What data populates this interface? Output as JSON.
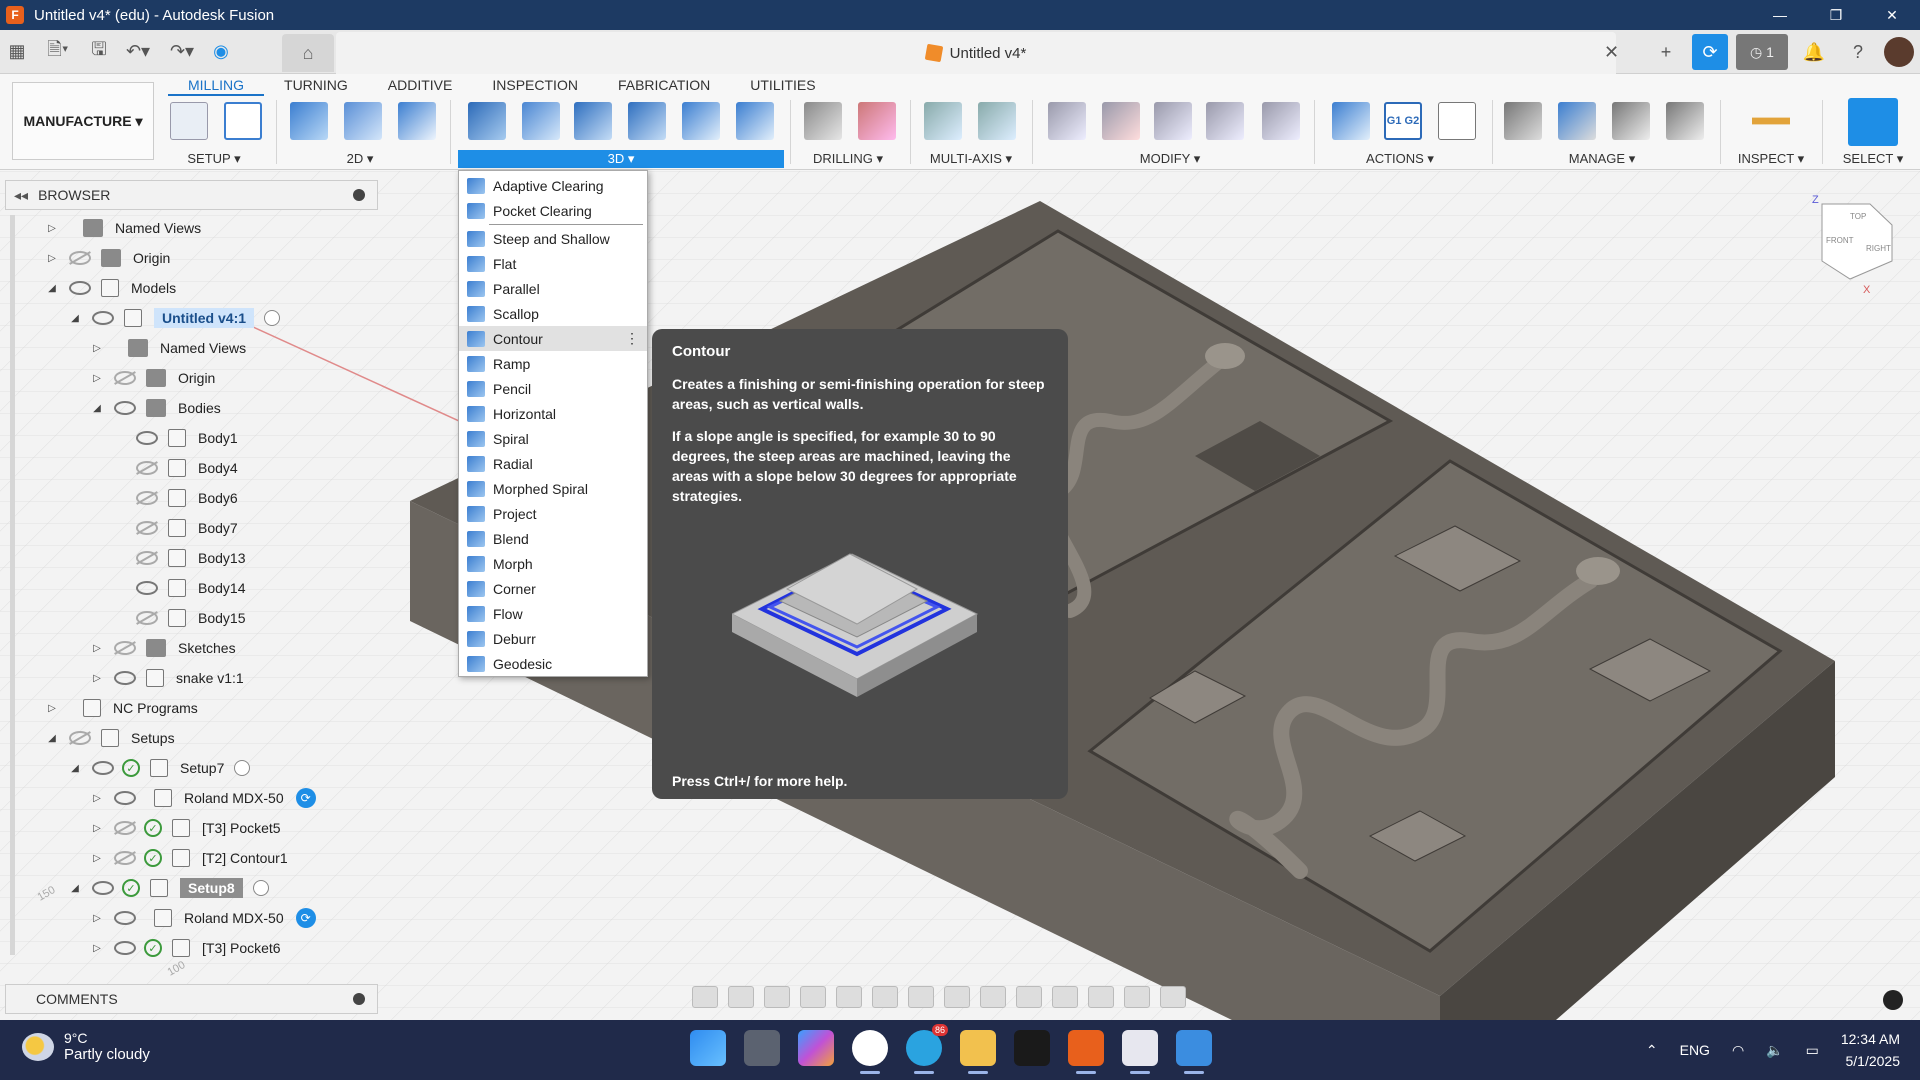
{
  "window": {
    "title": "Untitled v4* (edu) - Autodesk Fusion",
    "controls": [
      "—",
      "❐",
      "✕"
    ]
  },
  "document": {
    "tab_title": "Untitled v4*",
    "jobs_count": "1"
  },
  "ribbon": {
    "workspace": "MANUFACTURE ▾",
    "tabs": [
      "MILLING",
      "TURNING",
      "ADDITIVE",
      "INSPECTION",
      "FABRICATION",
      "UTILITIES"
    ],
    "groups": {
      "setup": "SETUP ▾",
      "two_d": "2D ▾",
      "three_d": "3D ▾",
      "drilling": "DRILLING ▾",
      "multi_axis": "MULTI-AXIS ▾",
      "modify": "MODIFY ▾",
      "actions": "ACTIONS ▾",
      "manage": "MANAGE ▾",
      "inspect": "INSPECT ▾",
      "select": "SELECT ▾"
    },
    "actions_g1g2": "G1 G2"
  },
  "browser": {
    "title": "BROWSER",
    "items": [
      {
        "label": "Named Views"
      },
      {
        "label": "Origin"
      },
      {
        "label": "Models"
      },
      {
        "label": "Untitled v4:1"
      },
      {
        "label": "Named Views"
      },
      {
        "label": "Origin"
      },
      {
        "label": "Bodies"
      },
      {
        "label": "Body1"
      },
      {
        "label": "Body4"
      },
      {
        "label": "Body6"
      },
      {
        "label": "Body7"
      },
      {
        "label": "Body13"
      },
      {
        "label": "Body14"
      },
      {
        "label": "Body15"
      },
      {
        "label": "Sketches"
      },
      {
        "label": "snake v1:1"
      },
      {
        "label": "NC Programs"
      },
      {
        "label": "Setups"
      },
      {
        "label": "Setup7"
      },
      {
        "label": "Roland MDX-50"
      },
      {
        "label": "[T3] Pocket5"
      },
      {
        "label": "[T2] Contour1"
      },
      {
        "label": "Setup8"
      },
      {
        "label": "Roland MDX-50"
      },
      {
        "label": "[T3] Pocket6"
      }
    ]
  },
  "comments": {
    "title": "COMMENTS"
  },
  "menu3d": {
    "items": [
      "Adaptive Clearing",
      "Pocket Clearing",
      "Steep and Shallow",
      "Flat",
      "Parallel",
      "Scallop",
      "Contour",
      "Ramp",
      "Pencil",
      "Horizontal",
      "Spiral",
      "Radial",
      "Morphed Spiral",
      "Project",
      "Blend",
      "Morph",
      "Corner",
      "Flow",
      "Deburr",
      "Geodesic"
    ],
    "hovered": "Contour"
  },
  "tooltip": {
    "title": "Contour",
    "para1": "Creates a finishing or semi-finishing operation for steep areas, such as vertical walls.",
    "para2": "If a slope angle is specified, for example 30 to 90 degrees, the steep areas are machined, leaving the areas with a slope below 30 degrees for appropriate strategies.",
    "help": "Press Ctrl+/ for more help."
  },
  "viewcube": {
    "top": "TOP",
    "front": "FRONT",
    "right": "RIGHT",
    "z": "Z",
    "x": "X"
  },
  "grid_labels": {
    "a": "150",
    "b": "100"
  },
  "taskbar": {
    "temp": "9°C",
    "condition": "Partly cloudy",
    "lang": "ENG",
    "time": "12:34 AM",
    "date": "5/1/2025",
    "telegram_badge": "86"
  },
  "colors": {
    "accent": "#1e8ee6",
    "titlebar": "#1d3a63",
    "taskbar": "#202a4a",
    "tooltip_bg": "#4b4b4b",
    "model": "#5b5650"
  }
}
